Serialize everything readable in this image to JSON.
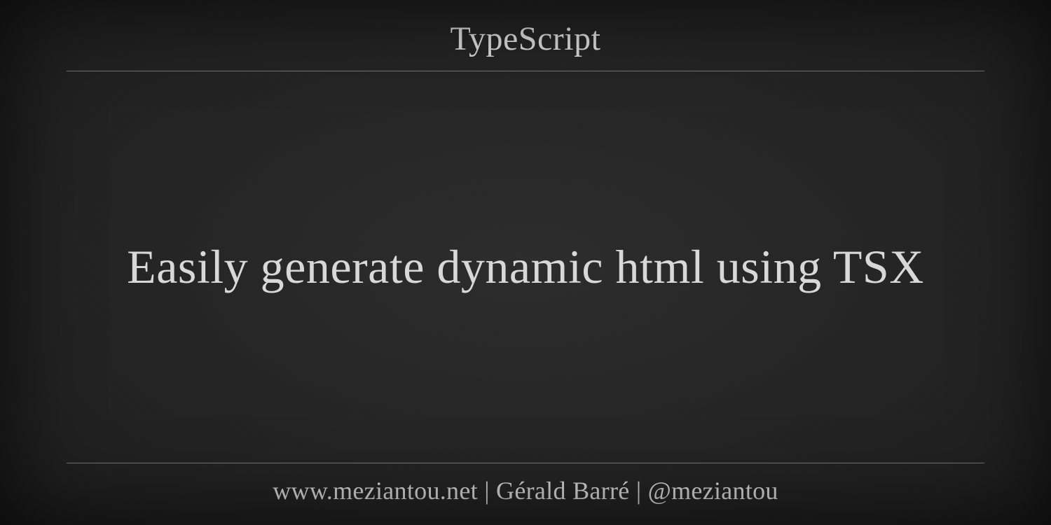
{
  "header": {
    "category": "TypeScript"
  },
  "main": {
    "title": "Easily generate dynamic html using TSX"
  },
  "footer": {
    "attribution": "www.meziantou.net | Gérald Barré | @meziantou"
  }
}
